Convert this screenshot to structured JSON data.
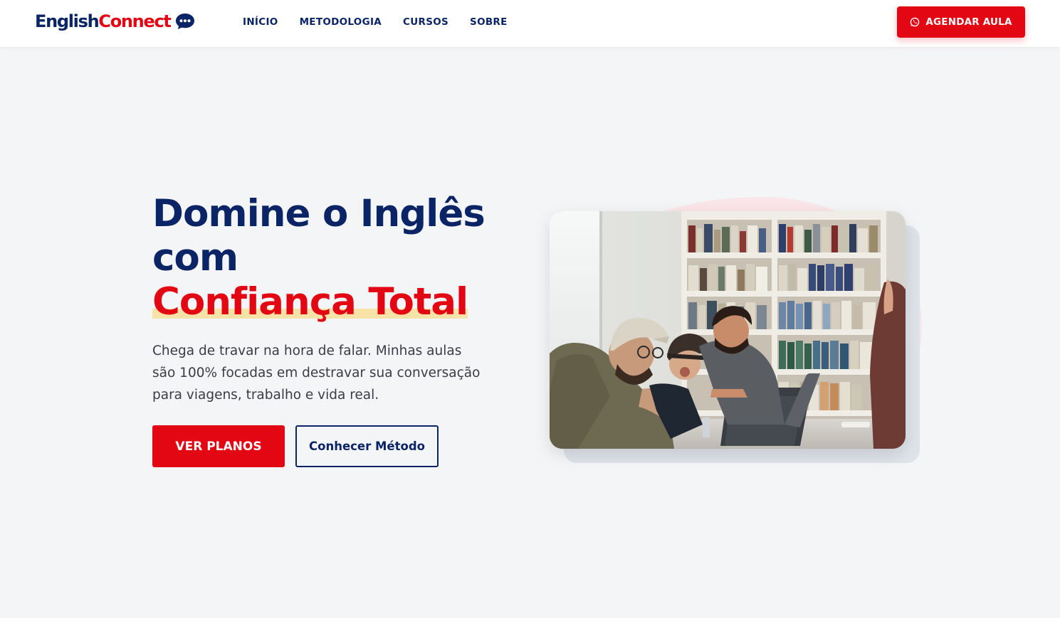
{
  "brand": {
    "part1": "English",
    "part2": "Connect",
    "icon": "chat-bubble-icon"
  },
  "nav": {
    "items": [
      {
        "label": "INÍCIO"
      },
      {
        "label": "METODOLOGIA"
      },
      {
        "label": "CURSOS"
      },
      {
        "label": "SOBRE"
      }
    ],
    "cta": {
      "label": "AGENDAR AULA",
      "icon": "whatsapp-icon"
    }
  },
  "hero": {
    "headline_line1": "Domine o Inglês",
    "headline_line2": "com",
    "headline_highlight": "Confiança Total",
    "subtitle": "Chega de travar na hora de falar. Minhas aulas são 100% focadas em destravar sua conversação para viagens, trabalho e vida real.",
    "primary_button": "VER PLANOS",
    "secondary_button": "Conhecer Método",
    "image_alt": "students-laughing-at-laptop-in-library"
  },
  "colors": {
    "navy": "#0b2466",
    "red": "#e30613",
    "highlight": "#f7e3a7",
    "background": "#f4f5f7"
  }
}
